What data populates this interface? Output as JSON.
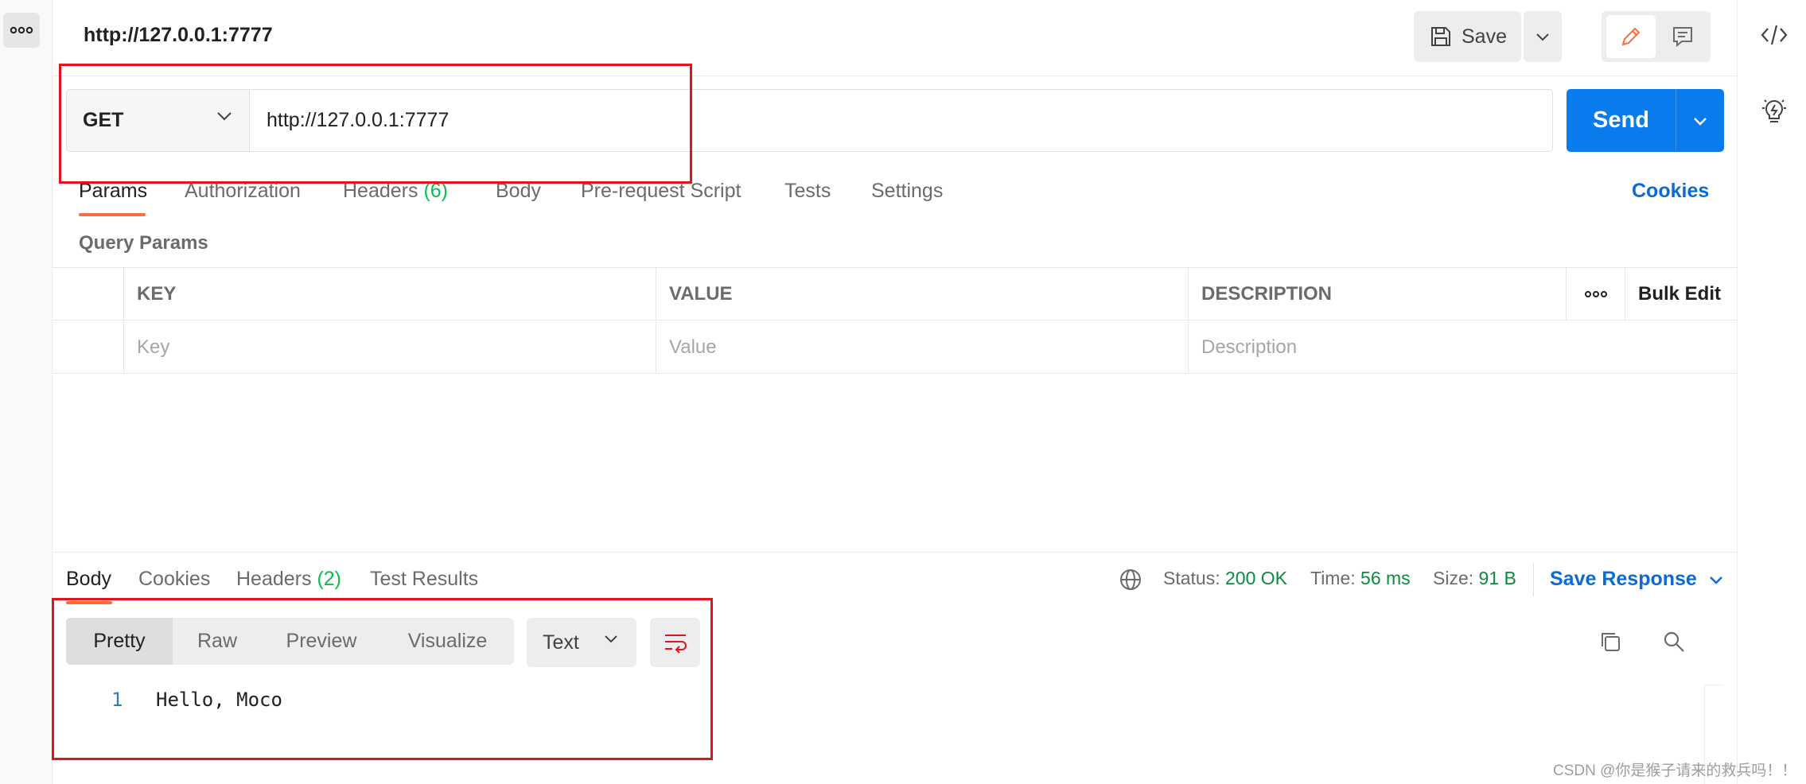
{
  "tab": {
    "title": "http://127.0.0.1:7777"
  },
  "toolbar": {
    "save_label": "Save"
  },
  "request": {
    "method": "GET",
    "url": "http://127.0.0.1:7777",
    "send_label": "Send"
  },
  "request_tabs": {
    "params": "Params",
    "authorization": "Authorization",
    "headers": "Headers",
    "headers_count": "(6)",
    "body": "Body",
    "prerequest": "Pre-request Script",
    "tests": "Tests",
    "settings": "Settings",
    "cookies": "Cookies"
  },
  "query_params": {
    "title": "Query Params",
    "columns": {
      "key": "KEY",
      "value": "VALUE",
      "description": "DESCRIPTION"
    },
    "bulk_edit": "Bulk Edit",
    "placeholders": {
      "key": "Key",
      "value": "Value",
      "description": "Description"
    }
  },
  "response_tabs": {
    "body": "Body",
    "cookies": "Cookies",
    "headers": "Headers",
    "headers_count": "(2)",
    "test_results": "Test Results"
  },
  "response_meta": {
    "status_label": "Status:",
    "status_value": "200 OK",
    "time_label": "Time:",
    "time_value": "56 ms",
    "size_label": "Size:",
    "size_value": "91 B",
    "save_response": "Save Response"
  },
  "response_view": {
    "modes": [
      "Pretty",
      "Raw",
      "Preview",
      "Visualize"
    ],
    "active_mode": "Pretty",
    "format": "Text"
  },
  "response_body": {
    "lines": [
      {
        "num": "1",
        "text": "Hello, Moco"
      }
    ]
  },
  "watermark": "CSDN @你是猴子请来的救兵吗！！",
  "colors": {
    "accent_blue": "#097bed",
    "link_blue": "#0b6ad9",
    "active_tab_orange": "#ff6c37",
    "status_green": "#0c8a3e",
    "annotation_red": "#e3131b"
  },
  "icons": [
    "more-dots-icon",
    "code-icon",
    "bulb-icon",
    "save-disk-icon",
    "chevron-down-icon",
    "pencil-icon",
    "comment-icon",
    "globe-icon",
    "wrap-lines-icon",
    "copy-icon",
    "search-icon"
  ]
}
